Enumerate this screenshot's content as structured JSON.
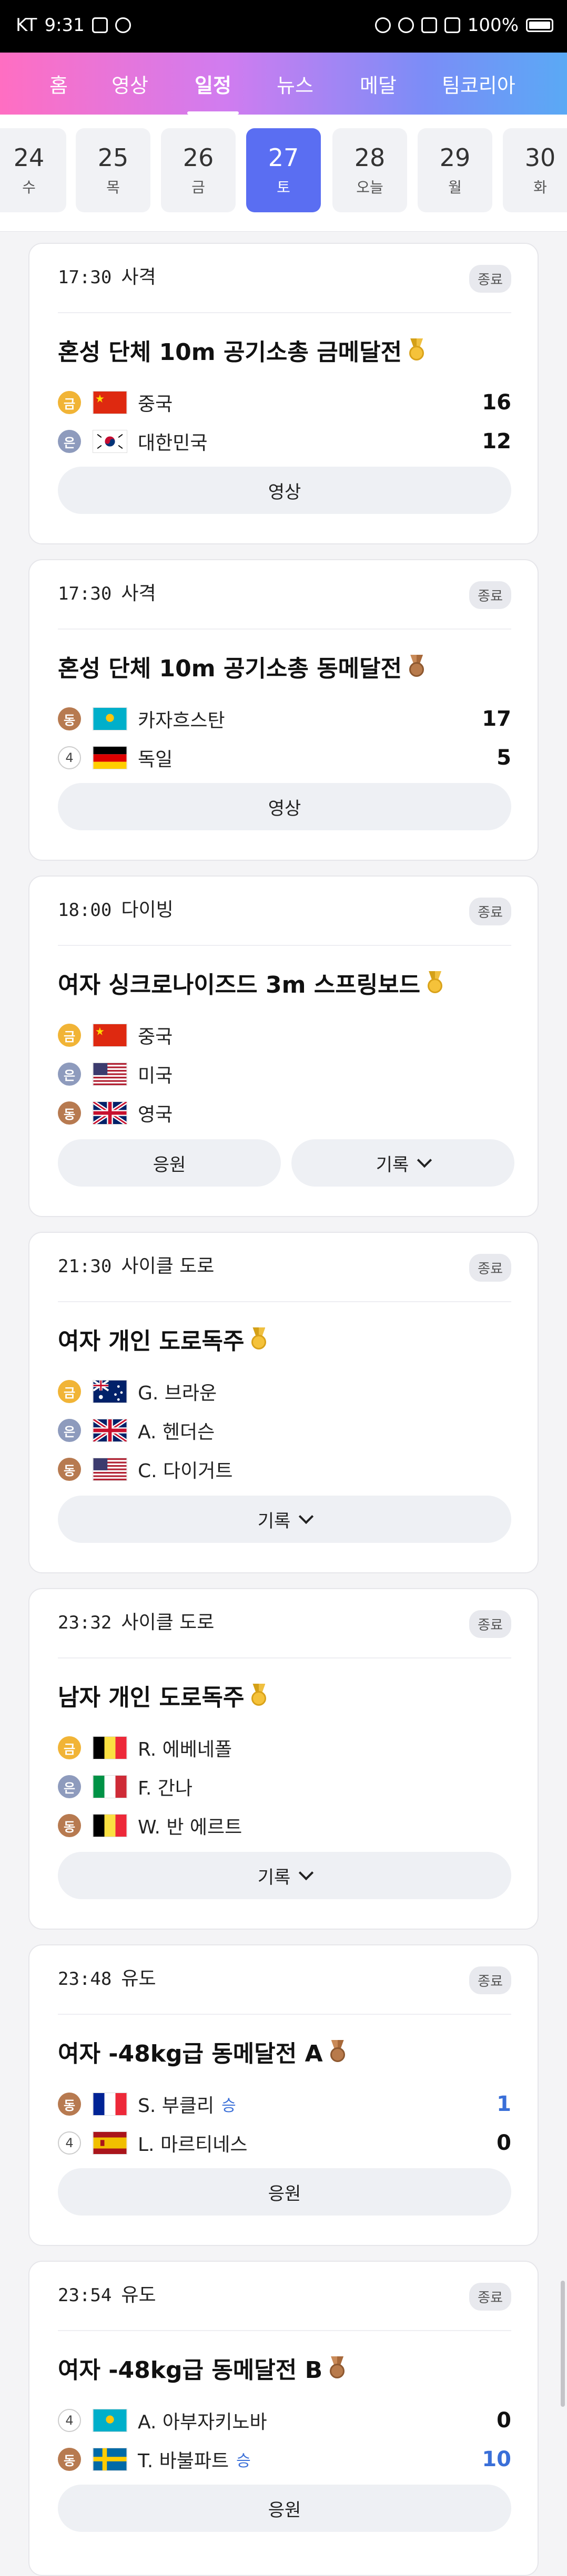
{
  "status": {
    "carrier": "KT",
    "time": "9:31",
    "battery": "100%"
  },
  "nav": {
    "tabs": [
      {
        "label": "홈"
      },
      {
        "label": "영상"
      },
      {
        "label": "일정"
      },
      {
        "label": "뉴스"
      },
      {
        "label": "메달"
      },
      {
        "label": "팀코리아"
      }
    ],
    "active": "일정"
  },
  "dates": [
    {
      "num": "24",
      "day": "수"
    },
    {
      "num": "25",
      "day": "목"
    },
    {
      "num": "26",
      "day": "금"
    },
    {
      "num": "27",
      "day": "토"
    },
    {
      "num": "28",
      "day": "오늘"
    },
    {
      "num": "29",
      "day": "월"
    },
    {
      "num": "30",
      "day": "화"
    }
  ],
  "cards": [
    {
      "time": "17:30",
      "sport": "사격",
      "badge": "종료",
      "title": "혼성 단체 10m 공기소총 금메달전",
      "medal": "gold",
      "rows": [
        {
          "mark": "금",
          "type": "gold",
          "flag": "china",
          "name": "중국",
          "score": "16"
        },
        {
          "mark": "은",
          "type": "silver",
          "flag": "korea",
          "name": "대한민국",
          "score": "12"
        }
      ],
      "buttons": [
        {
          "label": "영상"
        }
      ]
    },
    {
      "time": "17:30",
      "sport": "사격",
      "badge": "종료",
      "title": "혼성 단체 10m 공기소총 동메달전",
      "medal": "bronze",
      "rows": [
        {
          "mark": "동",
          "type": "bronze",
          "flag": "kazakhstan",
          "name": "카자흐스탄",
          "score": "17"
        },
        {
          "mark": "4",
          "type": "rank",
          "flag": "germany",
          "name": "독일",
          "score": "5"
        }
      ],
      "buttons": [
        {
          "label": "영상"
        }
      ]
    },
    {
      "time": "18:00",
      "sport": "다이빙",
      "badge": "종료",
      "title": "여자 싱크로나이즈드 3m 스프링보드",
      "medal": "gold",
      "rows": [
        {
          "mark": "금",
          "type": "gold",
          "flag": "china",
          "name": "중국"
        },
        {
          "mark": "은",
          "type": "silver",
          "flag": "usa",
          "name": "미국"
        },
        {
          "mark": "동",
          "type": "bronze",
          "flag": "uk",
          "name": "영국"
        }
      ],
      "buttons": [
        {
          "label": "응원"
        },
        {
          "label": "기록",
          "chevron": true
        }
      ]
    },
    {
      "time": "21:30",
      "sport": "사이클 도로",
      "badge": "종료",
      "title": "여자 개인 도로독주",
      "medal": "gold",
      "rows": [
        {
          "mark": "금",
          "type": "gold",
          "flag": "australia",
          "name": "G. 브라운"
        },
        {
          "mark": "은",
          "type": "silver",
          "flag": "uk",
          "name": "A. 헨더슨"
        },
        {
          "mark": "동",
          "type": "bronze",
          "flag": "usa",
          "name": "C. 다이거트"
        }
      ],
      "buttons": [
        {
          "label": "기록",
          "chevron": true
        }
      ]
    },
    {
      "time": "23:32",
      "sport": "사이클 도로",
      "badge": "종료",
      "title": "남자 개인 도로독주",
      "medal": "gold",
      "rows": [
        {
          "mark": "금",
          "type": "gold",
          "flag": "belgium",
          "name": "R. 에베네폴"
        },
        {
          "mark": "은",
          "type": "silver",
          "flag": "italy",
          "name": "F. 간나"
        },
        {
          "mark": "동",
          "type": "bronze",
          "flag": "belgium",
          "name": "W. 반 에르트"
        }
      ],
      "buttons": [
        {
          "label": "기록",
          "chevron": true
        }
      ]
    },
    {
      "time": "23:48",
      "sport": "유도",
      "badge": "종료",
      "title": "여자 -48kg급 동메달전 A",
      "medal": "bronze",
      "rows": [
        {
          "mark": "동",
          "type": "bronze",
          "flag": "france",
          "name": "S. 부클리",
          "win": "승",
          "score": "1",
          "blue": true
        },
        {
          "mark": "4",
          "type": "rank",
          "flag": "spain",
          "name": "L. 마르티네스",
          "score": "0"
        }
      ],
      "buttons": [
        {
          "label": "응원"
        }
      ]
    },
    {
      "time": "23:54",
      "sport": "유도",
      "badge": "종료",
      "title": "여자 -48kg급 동메달전 B",
      "medal": "bronze",
      "rows": [
        {
          "mark": "4",
          "type": "rank",
          "flag": "kazakhstan",
          "name": "A. 아부자키노바",
          "score": "0"
        },
        {
          "mark": "동",
          "type": "bronze",
          "flag": "sweden",
          "name": "T. 바불파트",
          "win": "승",
          "score": "10",
          "blue": true
        }
      ],
      "buttons": [
        {
          "label": "응원"
        }
      ]
    }
  ]
}
